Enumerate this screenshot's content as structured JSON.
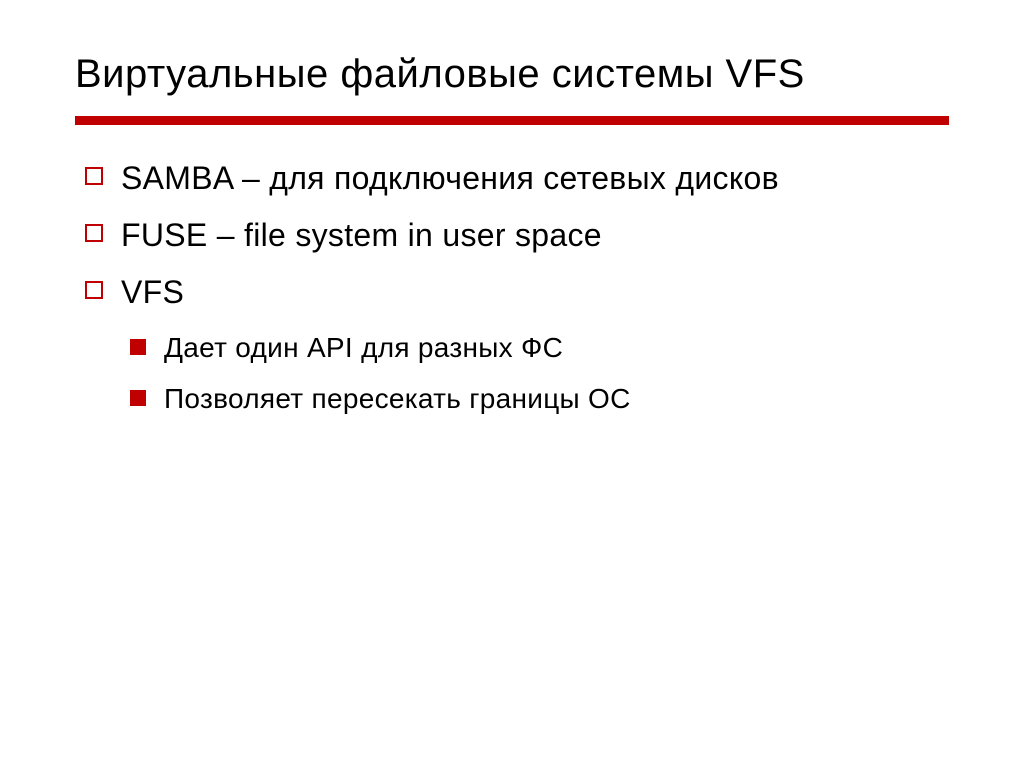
{
  "slide": {
    "title": "Виртуальные файловые системы VFS",
    "bullets": [
      {
        "text": "SAMBA – для подключения сетевых дисков",
        "subitems": []
      },
      {
        "text": "FUSE – file system in user space",
        "subitems": []
      },
      {
        "text": "VFS",
        "subitems": [
          "Дает один API для разных ФС",
          "Позволяет пересекать границы ОС"
        ]
      }
    ]
  }
}
